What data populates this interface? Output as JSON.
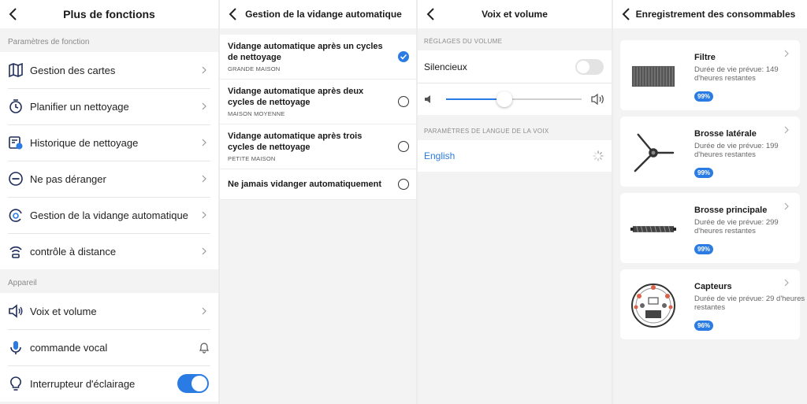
{
  "panel1": {
    "title": "Plus de fonctions",
    "section1": "Paramètres de fonction",
    "items1": [
      {
        "label": "Gestion des cartes",
        "icon": "map-icon"
      },
      {
        "label": "Planifier un nettoyage",
        "icon": "clock-icon"
      },
      {
        "label": "Historique de nettoyage",
        "icon": "history-icon"
      },
      {
        "label": "Ne pas déranger",
        "icon": "do-not-disturb-icon"
      },
      {
        "label": "Gestion de la vidange automatique",
        "icon": "auto-empty-icon"
      },
      {
        "label": "contrôle à distance",
        "icon": "remote-control-icon"
      }
    ],
    "section2": "Appareil",
    "items2": [
      {
        "label": "Voix et volume",
        "icon": "speaker-icon"
      },
      {
        "label": "commande vocal",
        "icon": "microphone-icon"
      },
      {
        "label": "Interrupteur d'éclairage",
        "icon": "light-bulb-icon",
        "toggle": true
      }
    ]
  },
  "panel2": {
    "title": "Gestion de la vidange automatique",
    "options": [
      {
        "title": "Vidange automatique après un cycles de nettoyage",
        "sub": "GRANDE MAISON",
        "selected": true
      },
      {
        "title": "Vidange automatique après deux cycles de nettoyage",
        "sub": "MAISON MOYENNE",
        "selected": false
      },
      {
        "title": "Vidange automatique après trois cycles de nettoyage",
        "sub": "PETITE MAISON",
        "selected": false
      },
      {
        "title": "Ne jamais vidanger automatiquement",
        "sub": "",
        "selected": false
      }
    ]
  },
  "panel3": {
    "title": "Voix et volume",
    "volume_section": "RÉGLAGES DU VOLUME",
    "silent_label": "Silencieux",
    "silent_on": false,
    "volume_level": 0.43,
    "lang_section": "PARAMÈTRES DE LANGUE DE LA VOIX",
    "language": "English"
  },
  "panel4": {
    "title": "Enregistrement des consommables",
    "items": [
      {
        "name": "Filtre",
        "desc": "Durée de vie prévue: 149 d'heures restantes",
        "pct": "99%",
        "icon": "filter-image"
      },
      {
        "name": "Brosse latérale",
        "desc": "Durée de vie prévue: 199 d'heures restantes",
        "pct": "99%",
        "icon": "side-brush-image"
      },
      {
        "name": "Brosse principale",
        "desc": "Durée de vie prévue: 299 d'heures restantes",
        "pct": "99%",
        "icon": "main-brush-image"
      },
      {
        "name": "Capteurs",
        "desc": "Durée de vie prévue: 29 d'heures restantes",
        "pct": "96%",
        "icon": "sensors-image"
      }
    ]
  },
  "colors": {
    "accent": "#2a7be4",
    "background": "#f3f3f3"
  }
}
